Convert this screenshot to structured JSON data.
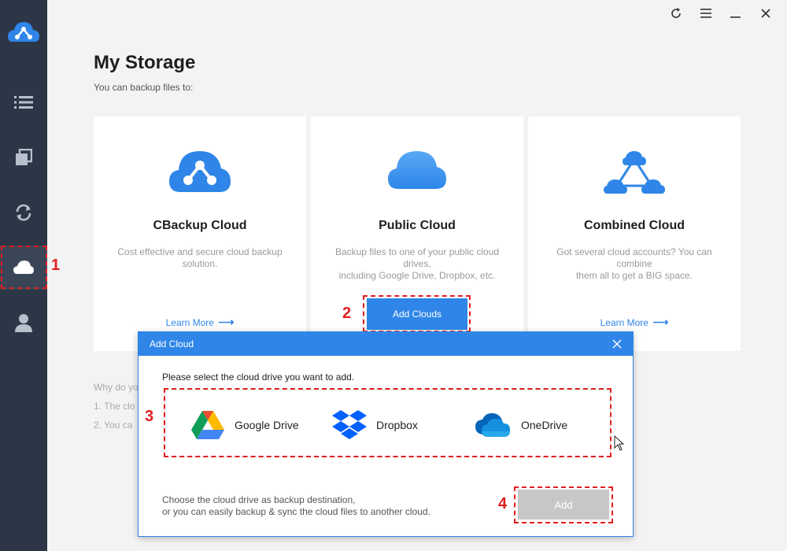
{
  "window": {
    "controls": [
      "refresh-icon",
      "menu-icon",
      "minimize-icon",
      "close-icon"
    ]
  },
  "sidebar": {
    "items": [
      {
        "name": "list-icon"
      },
      {
        "name": "copy-icon"
      },
      {
        "name": "sync-icon"
      },
      {
        "name": "cloud-icon",
        "active": true
      },
      {
        "name": "user-icon"
      }
    ]
  },
  "page": {
    "title": "My Storage",
    "subtitle": "You can backup files to:"
  },
  "cards": [
    {
      "title": "CBackup Cloud",
      "desc_line1": "Cost effective and secure cloud backup",
      "desc_line2": "solution.",
      "link": "Learn More"
    },
    {
      "title": "Public Cloud",
      "desc_line1": "Backup files to one of your public cloud drives,",
      "desc_line2": "including Google Drive, Dropbox, etc.",
      "button": "Add Clouds"
    },
    {
      "title": "Combined Cloud",
      "desc_line1": "Got several cloud accounts? You can combine",
      "desc_line2": "them all to get a BIG space.",
      "link": "Learn More"
    }
  ],
  "why": {
    "line0": "Why do yo",
    "line1": "1. The clo",
    "line2": "2. You ca"
  },
  "annotations": [
    "1",
    "2",
    "3",
    "4"
  ],
  "dialog": {
    "title": "Add Cloud",
    "prompt": "Please select the cloud drive you want to add.",
    "drives": [
      "Google Drive",
      "Dropbox",
      "OneDrive"
    ],
    "footer_line1": "Choose the cloud drive as backup destination,",
    "footer_line2": "or you can easily backup & sync the cloud files to another cloud.",
    "add_label": "Add"
  },
  "colors": {
    "accent": "#2f86e8",
    "sidebar": "#2c3646",
    "annotation": "#e21e1e",
    "disabled": "#c7c7c7"
  }
}
